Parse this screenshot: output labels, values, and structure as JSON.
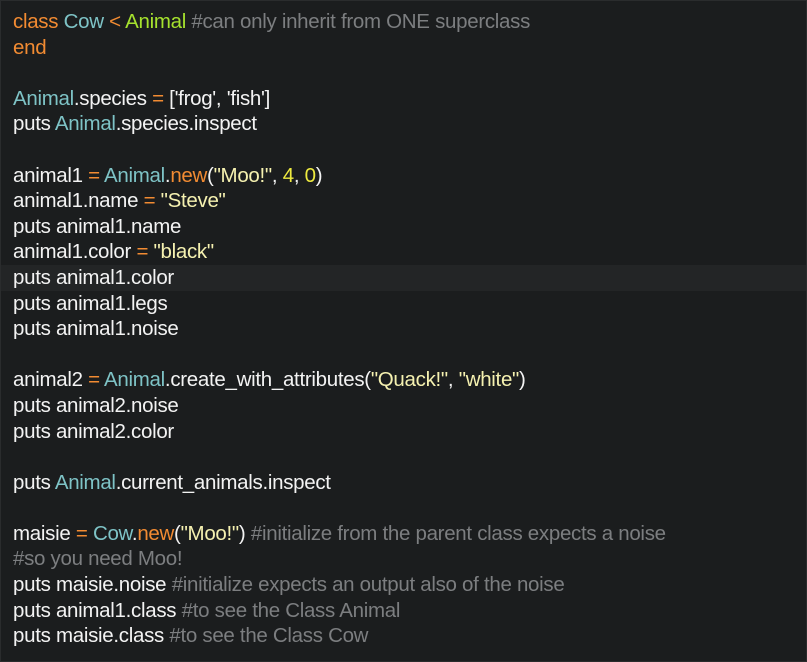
{
  "editor": {
    "colors": {
      "background": "#1b1d1e",
      "keyword": "#f28b32",
      "class_name": "#7ec3c6",
      "superclass": "#a6e22e",
      "string": "#f5f1b0",
      "number": "#eeea3f",
      "comment": "#7c7e80",
      "text": "#f3f3f3"
    },
    "line1": {
      "kw_class": "class",
      "name": "Cow",
      "lt": "<",
      "superclass": "Animal",
      "comment": "#can only inherit from ONE superclass"
    },
    "line2": {
      "kw_end": "end"
    },
    "line4": {
      "cls": "Animal",
      "rest": ".species",
      "eq": "=",
      "arr": "['frog', 'fish']"
    },
    "line5": {
      "puts": "puts",
      "cls": "Animal",
      "rest": ".species.inspect"
    },
    "line7": {
      "var": "animal1",
      "eq": "=",
      "cls": "Animal",
      "dot": ".",
      "new": "new",
      "paren_open": "(",
      "str": "\"Moo!\"",
      "comma1": ", ",
      "n1": "4",
      "comma2": ", ",
      "n2": "0",
      "paren_close": ")"
    },
    "line8": {
      "lhs": "animal1.name",
      "eq": "=",
      "str": "\"Steve\""
    },
    "line9": {
      "text": "puts animal1.name"
    },
    "line10": {
      "lhs": "animal1.color",
      "eq": "=",
      "str": "\"black\""
    },
    "line11": {
      "text": "puts animal1.color"
    },
    "line12": {
      "text": "puts animal1.legs"
    },
    "line13": {
      "text": "puts animal1.noise"
    },
    "line15": {
      "var": "animal2",
      "eq": "=",
      "cls": "Animal",
      "method": ".create_with_attributes(",
      "s1": "\"Quack!\"",
      "comma": ", ",
      "s2": "\"white\"",
      "close": ")"
    },
    "line16": {
      "text": "puts animal2.noise"
    },
    "line17": {
      "text": "puts animal2.color"
    },
    "line19": {
      "puts": "puts",
      "cls": "Animal",
      "rest": ".current_animals.inspect"
    },
    "line21": {
      "var": "maisie",
      "eq": "=",
      "cls": "Cow",
      "dot": ".",
      "new": "new",
      "open": "(",
      "str": "\"Moo!\"",
      "close": ")",
      "comment": "#initialize from the parent class expects a noise"
    },
    "line22": {
      "comment": "#so you need Moo!"
    },
    "line23": {
      "code": "puts maisie.noise",
      "comment": "#initialize expects an output also of the noise"
    },
    "line24": {
      "code": "puts animal1.class",
      "comment": "#to see the Class Animal"
    },
    "line25": {
      "code": "puts maisie.class",
      "comment": "#to see the Class Cow"
    }
  }
}
